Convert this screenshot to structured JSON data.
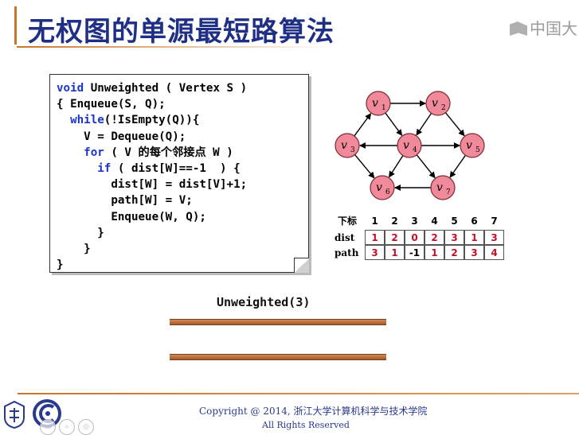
{
  "title": "无权图的单源最短路算法",
  "watermark": {
    "text": "中国大",
    "icon": "mooc-logo-icon"
  },
  "code": {
    "lines": [
      [
        {
          "t": "void ",
          "k": true
        },
        {
          "t": "Unweighted ( Vertex S )",
          "k": false
        }
      ],
      [
        {
          "t": "{ Enqueue(S, Q);",
          "k": false
        }
      ],
      [
        {
          "t": "  while",
          "k": true
        },
        {
          "t": "(!IsEmpty(Q)){",
          "k": false
        }
      ],
      [
        {
          "t": "    V = Dequeue(Q);",
          "k": false
        }
      ],
      [
        {
          "t": "    for",
          "k": true
        },
        {
          "t": " ( V 的每个邻接点 W )",
          "k": false
        }
      ],
      [
        {
          "t": "      if",
          "k": true
        },
        {
          "t": " ( dist[W]==-1  ) {",
          "k": false
        }
      ],
      [
        {
          "t": "        dist[W] = dist[V]+1;",
          "k": false
        }
      ],
      [
        {
          "t": "        path[W] = V;",
          "k": false
        }
      ],
      [
        {
          "t": "        Enqueue(W, Q);",
          "k": false
        }
      ],
      [
        {
          "t": "      }",
          "k": false
        }
      ],
      [
        {
          "t": "    }",
          "k": false
        }
      ],
      [
        {
          "t": "}",
          "k": false
        }
      ]
    ]
  },
  "graph": {
    "node_color": "#f08a9a",
    "nodes": [
      {
        "id": "v1",
        "label": "v",
        "sub": "1"
      },
      {
        "id": "v2",
        "label": "v",
        "sub": "2"
      },
      {
        "id": "v3",
        "label": "v",
        "sub": "3"
      },
      {
        "id": "v4",
        "label": "v",
        "sub": "4"
      },
      {
        "id": "v5",
        "label": "v",
        "sub": "5"
      },
      {
        "id": "v6",
        "label": "v",
        "sub": "6"
      },
      {
        "id": "v7",
        "label": "v",
        "sub": "7"
      }
    ],
    "edges": [
      [
        "v1",
        "v2"
      ],
      [
        "v1",
        "v4"
      ],
      [
        "v2",
        "v4"
      ],
      [
        "v2",
        "v5"
      ],
      [
        "v3",
        "v1"
      ],
      [
        "v3",
        "v6"
      ],
      [
        "v4",
        "v3"
      ],
      [
        "v4",
        "v5"
      ],
      [
        "v4",
        "v6"
      ],
      [
        "v4",
        "v7"
      ],
      [
        "v5",
        "v7"
      ],
      [
        "v7",
        "v6"
      ]
    ]
  },
  "table": {
    "header_label": "下标",
    "indices": [
      "1",
      "2",
      "3",
      "4",
      "5",
      "6",
      "7"
    ],
    "rows": [
      {
        "label": "dist",
        "values": [
          "1",
          "2",
          "0",
          "2",
          "3",
          "1",
          "3"
        ]
      },
      {
        "label": "path",
        "values": [
          "3",
          "1",
          "-1",
          "1",
          "2",
          "3",
          "4"
        ]
      }
    ]
  },
  "call_label": "Unweighted(3)",
  "footer": {
    "copyright": "Copyright @ 2014, 浙江大学计算机科学与技术学院",
    "rights": "All Rights Reserved",
    "icons": [
      "zju-seal-icon",
      "course-logo-icon",
      "media-control-icon",
      "search-icon",
      "speed-icon"
    ]
  }
}
